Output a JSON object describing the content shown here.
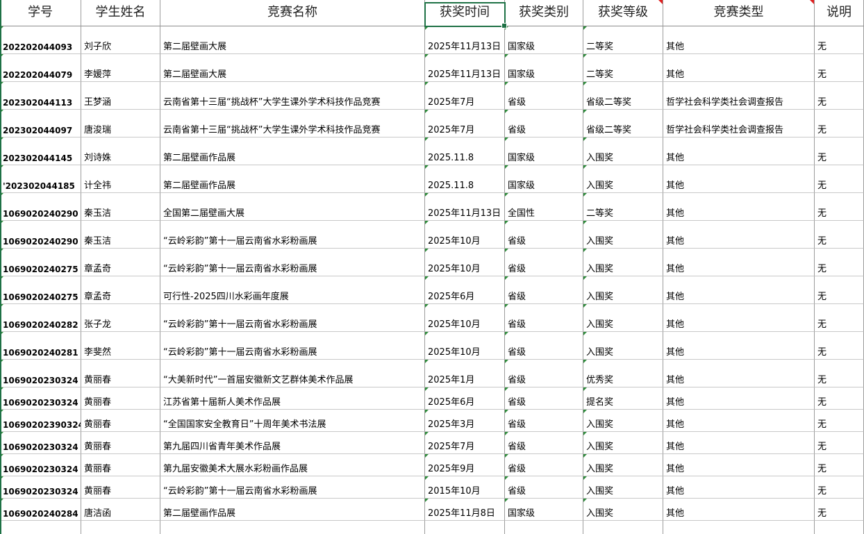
{
  "headers": [
    "学号",
    "学生姓名",
    "竞赛名称",
    "获奖时间",
    "获奖类别",
    "获奖等级",
    "竞赛类型",
    "说明"
  ],
  "rows": [
    [
      "202202044093",
      "刘子欣",
      "第二届壁画大展",
      "2025年11月13日",
      "国家级",
      "二等奖",
      "其他",
      "无"
    ],
    [
      "202202044079",
      "李媛萍",
      "第二届壁画大展",
      "2025年11月13日",
      "国家级",
      "二等奖",
      "其他",
      "无"
    ],
    [
      "202302044113",
      "王梦涵",
      "云南省第十三届“挑战杯”大学生课外学术科技作品竞赛",
      "2025年7月",
      "省级",
      "省级二等奖",
      "哲学社会科学类社会调查报告",
      "无"
    ],
    [
      "202302044097",
      "唐浚瑞",
      "云南省第十三届“挑战杯”大学生课外学术科技作品竞赛",
      "2025年7月",
      "省级",
      "省级二等奖",
      "哲学社会科学类社会调查报告",
      "无"
    ],
    [
      "202302044145",
      "刘诗姝",
      "第二届壁画作品展",
      "2025.11.8",
      "国家级",
      "入围奖",
      "其他",
      "无"
    ],
    [
      "'202302044185",
      "计全祎",
      "第二届壁画作品展",
      "2025.11.8",
      "国家级",
      "入围奖",
      "其他",
      "无"
    ],
    [
      "1069020240290",
      "秦玉洁",
      "全国第二届壁画大展",
      "2025年11月13日",
      "全国性",
      "二等奖",
      "其他",
      "无"
    ],
    [
      "1069020240290",
      "秦玉洁",
      "“云岭彩韵”第十一届云南省水彩粉画展",
      "2025年10月",
      "省级",
      "入围奖",
      "其他",
      "无"
    ],
    [
      "1069020240275",
      "章孟奇",
      "“云岭彩韵”第十一届云南省水彩粉画展",
      "2025年10月",
      "省级",
      "入围奖",
      "其他",
      "无"
    ],
    [
      "1069020240275",
      "章孟奇",
      "可行性-2025四川水彩画年度展",
      "2025年6月",
      "省级",
      "入围奖",
      "其他",
      "无"
    ],
    [
      "1069020240282",
      "张子龙",
      "“云岭彩韵”第十一届云南省水彩粉画展",
      "2025年10月",
      "省级",
      "入围奖",
      "其他",
      "无"
    ],
    [
      "1069020240281",
      "李斐然",
      "“云岭彩韵”第十一届云南省水彩粉画展",
      "2025年10月",
      "省级",
      "入围奖",
      "其他",
      "无"
    ],
    [
      "1069020230324",
      "黄丽春",
      "“大美新时代”一首届安徽新文艺群体美术作品展",
      "2025年1月",
      "省级",
      "优秀奖",
      "其他",
      "无"
    ],
    [
      "1069020230324",
      "黄丽春",
      "江苏省第十届新人美术作品展",
      "2025年6月",
      "省级",
      "提名奖",
      "其他",
      "无"
    ],
    [
      "10690202390324",
      "黄丽春",
      "“全国国家安全教育日”十周年美术书法展",
      "2025年3月",
      "省级",
      "入围奖",
      "其他",
      "无"
    ],
    [
      "1069020230324",
      "黄丽春",
      "第九届四川省青年美术作品展",
      "2025年7月",
      "省级",
      "入围奖",
      "其他",
      "无"
    ],
    [
      "1069020230324",
      "黄丽春",
      "第九届安徽美术大展水彩粉画作品展",
      "2025年9月",
      "省级",
      "入围奖",
      "其他",
      "无"
    ],
    [
      "1069020230324",
      "黄丽春",
      "“云岭彩韵”第十一届云南省水彩粉画展",
      "2015年10月",
      "省级",
      "入围奖",
      "其他",
      "无"
    ],
    [
      "1069020240284",
      "唐洁函",
      "第二届壁画作品展",
      "2025年11月8日",
      "国家级",
      "入围奖",
      "其他",
      "无"
    ]
  ]
}
